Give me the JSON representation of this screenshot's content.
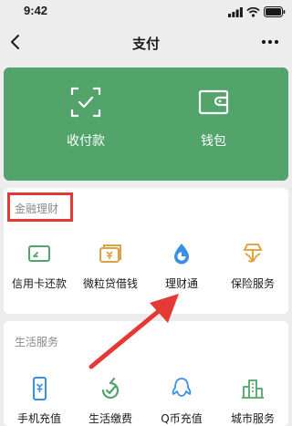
{
  "status": {
    "time": "9:42"
  },
  "nav": {
    "title": "支付",
    "back_icon": "chevron-left-icon",
    "more_icon": "ellipsis-icon"
  },
  "top_card": {
    "color": "#52a46b",
    "items": [
      {
        "label": "收付款",
        "icon": "scan-check-icon"
      },
      {
        "label": "钱包",
        "icon": "wallet-icon"
      }
    ]
  },
  "finance": {
    "title": "金融理财",
    "highlight_color": "#e53935",
    "items": [
      {
        "label": "信用卡还款",
        "icon": "credit-card-icon"
      },
      {
        "label": "微粒贷借钱",
        "icon": "loan-icon"
      },
      {
        "label": "理财通",
        "icon": "wealth-drop-icon"
      },
      {
        "label": "保险服务",
        "icon": "insurance-icon"
      }
    ]
  },
  "life": {
    "title": "生活服务",
    "items": [
      {
        "label": "手机充值",
        "icon": "mobile-topup-icon"
      },
      {
        "label": "生活缴费",
        "icon": "utility-bill-icon"
      },
      {
        "label": "Q币充值",
        "icon": "qq-coin-icon"
      },
      {
        "label": "城市服务",
        "icon": "city-services-icon"
      }
    ]
  }
}
